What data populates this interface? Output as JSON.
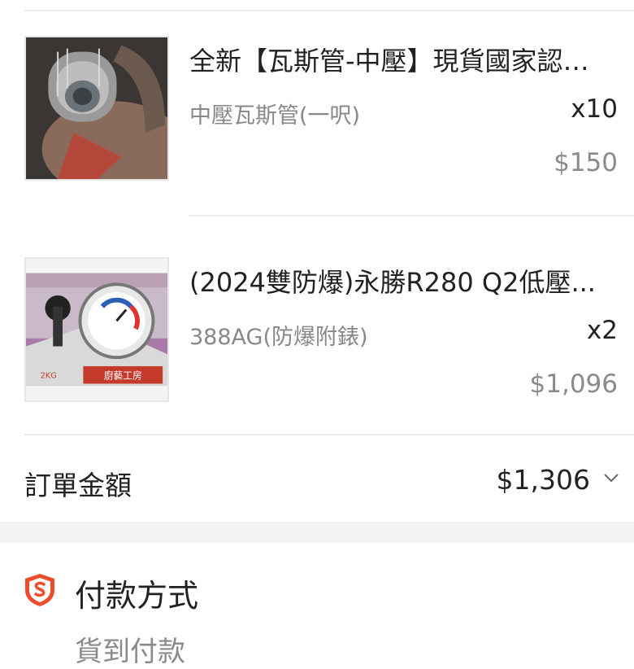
{
  "items": [
    {
      "title": "全新【瓦斯管-中壓】現貨國家認證...",
      "variant": "中壓瓦斯管(一呎)",
      "quantity": "x10",
      "price": "$150",
      "image_icon": "gas-hose-photo"
    },
    {
      "title": "(2024雙防爆)永勝R280 Q2低壓...",
      "variant": "388AG(防爆附錶)",
      "quantity": "x2",
      "price": "$1,096",
      "image_icon": "gas-regulator-photo",
      "image_caption": "廚藝工房",
      "image_tag": "2KG"
    }
  ],
  "order_total": {
    "label": "訂單金額",
    "value": "$1,306"
  },
  "payment": {
    "title": "付款方式",
    "method": "貨到付款",
    "icon": "shopee-shield-icon"
  },
  "colors": {
    "accent": "#ee4d2d",
    "muted_text": "#888888",
    "divider": "#ececec",
    "section_bg": "#f3f3f3"
  }
}
